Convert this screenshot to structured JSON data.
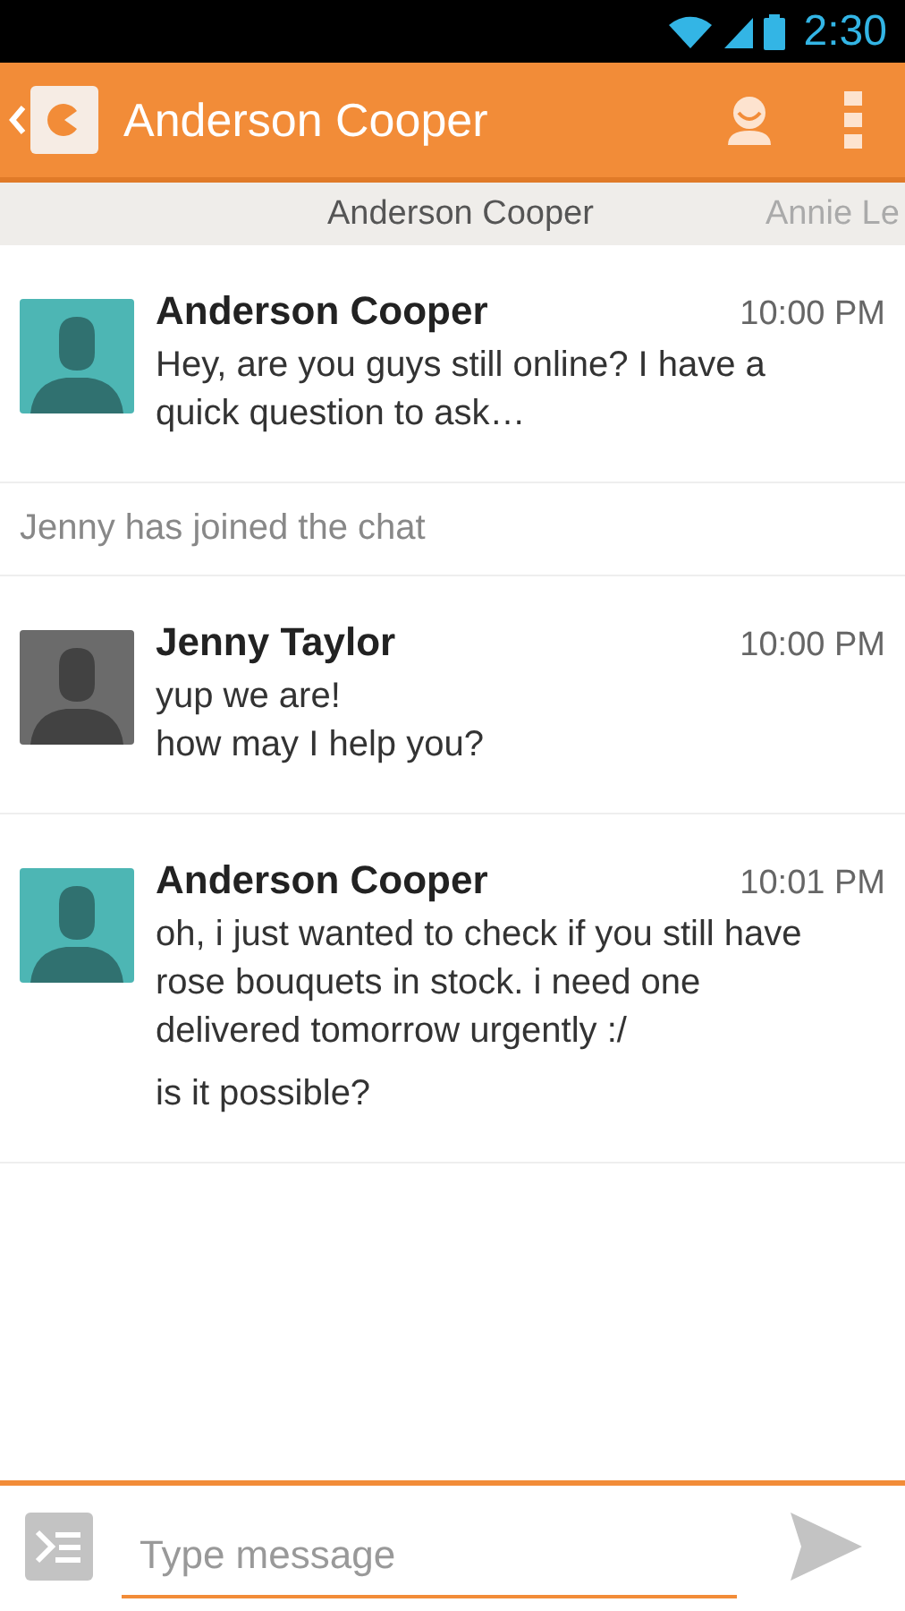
{
  "status_bar": {
    "time": "2:30"
  },
  "app_bar": {
    "title": "Anderson Cooper"
  },
  "tabs": [
    {
      "label": "Anderson Cooper",
      "selected": true
    },
    {
      "label": "Annie Le",
      "selected": false
    }
  ],
  "feed": [
    {
      "kind": "message",
      "sender": "Anderson Cooper",
      "time": "10:00 PM",
      "color": "#4db6b4",
      "paragraphs": [
        "Hey, are you guys still online? I have a quick question to ask…"
      ]
    },
    {
      "kind": "notice",
      "text": "Jenny has joined the chat"
    },
    {
      "kind": "message",
      "sender": "Jenny Taylor",
      "time": "10:00 PM",
      "color": "#6b6b6b",
      "paragraphs": [
        "yup we are!\nhow may I help you?"
      ]
    },
    {
      "kind": "message",
      "sender": "Anderson Cooper",
      "time": "10:01 PM",
      "color": "#4db6b4",
      "paragraphs": [
        "oh, i just wanted to check if you still have rose bouquets in stock. i need one delivered tomorrow urgently :/",
        "is it possible?"
      ]
    }
  ],
  "composer": {
    "placeholder": "Type message"
  }
}
